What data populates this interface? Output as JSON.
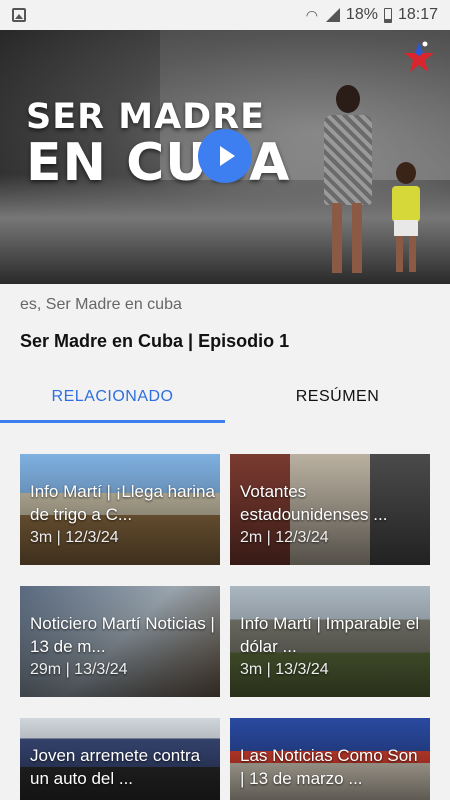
{
  "status_bar": {
    "battery": "18%",
    "time": "18:17",
    "icons": [
      "gallery-icon",
      "wifi-icon",
      "signal-icon",
      "battery-icon"
    ]
  },
  "video": {
    "overlay_title_line1": "SER MADRE",
    "overlay_title_line2": "EN CUBA",
    "play_icon": "play-icon",
    "accent_color": "#3d7ef0"
  },
  "show": {
    "subtitle": "es, Ser Madre en cuba",
    "episode_title": "Ser Madre en Cuba | Episodio 1"
  },
  "tabs": [
    {
      "label": "RELACIONADO",
      "active": true
    },
    {
      "label": "RESÚMEN",
      "active": false
    }
  ],
  "related": [
    {
      "title": "Info Martí | ¡Llega harina de trigo a C...",
      "meta": "3m | 12/3/24"
    },
    {
      "title": "Votantes estadounidenses ...",
      "meta": "2m | 12/3/24"
    },
    {
      "title": "Noticiero Martí Noticias | 13 de m...",
      "meta": "29m | 13/3/24"
    },
    {
      "title": "Info Martí | Imparable el dólar ...",
      "meta": "3m | 13/3/24"
    },
    {
      "title": "Joven arremete contra un auto del ...",
      "meta": ""
    },
    {
      "title": "Las Noticias Como Son | 13 de marzo ...",
      "meta": ""
    }
  ]
}
